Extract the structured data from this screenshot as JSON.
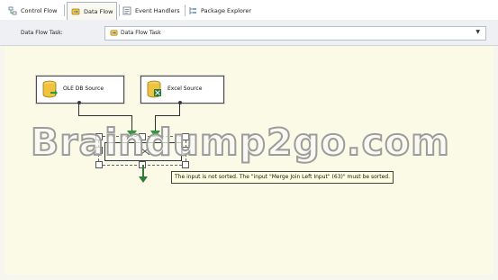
{
  "tabs": [
    {
      "label": "Control Flow",
      "icon": "control-flow-icon",
      "active": false
    },
    {
      "label": "Data Flow",
      "icon": "data-flow-icon",
      "active": true
    },
    {
      "label": "Event Handlers",
      "icon": "event-handlers-icon",
      "active": false
    },
    {
      "label": "Package Explorer",
      "icon": "package-explorer-icon",
      "active": false
    }
  ],
  "task": {
    "label": "Data Flow Task:",
    "selected": "Data Flow Task",
    "icon": "data-flow-task-icon"
  },
  "components": {
    "ole_db_source": {
      "label": "OLE DB Source",
      "icon": "database-source-icon"
    },
    "excel_source": {
      "label": "Excel Source",
      "icon": "excel-source-icon"
    },
    "merge_join": {
      "label": "Merge Join",
      "icon": "merge-join-icon"
    }
  },
  "tooltip": {
    "text": "The input is not sorted. The \"input \"Merge Join Left Input\" (63)\" must be sorted."
  },
  "watermark": {
    "text": "Braindump2go.com"
  },
  "colors": {
    "canvas": "#fafae6",
    "tooltip": "#ffffe1",
    "path_green": "#2e9b3b"
  }
}
